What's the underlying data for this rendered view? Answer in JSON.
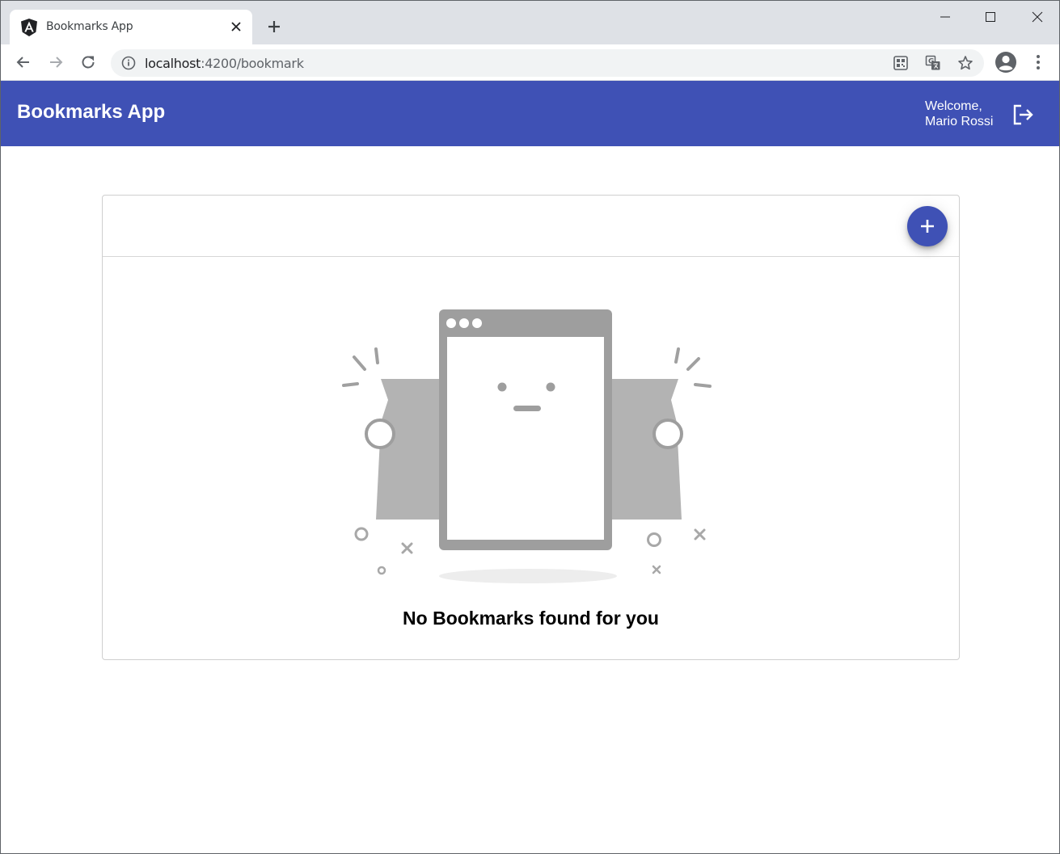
{
  "browser": {
    "tab": {
      "title": "Bookmarks App",
      "favicon": "angular-icon"
    },
    "url": {
      "host": "localhost",
      "path": ":4200/bookmark"
    }
  },
  "app": {
    "title": "Bookmarks App",
    "welcome_line1": "Welcome,",
    "welcome_line2": "Mario Rossi",
    "colors": {
      "primary": "#3f51b5",
      "illustration_gray": "#9e9e9e"
    }
  },
  "content": {
    "empty_message": "No Bookmarks found for you",
    "add_icon": "plus-icon"
  }
}
